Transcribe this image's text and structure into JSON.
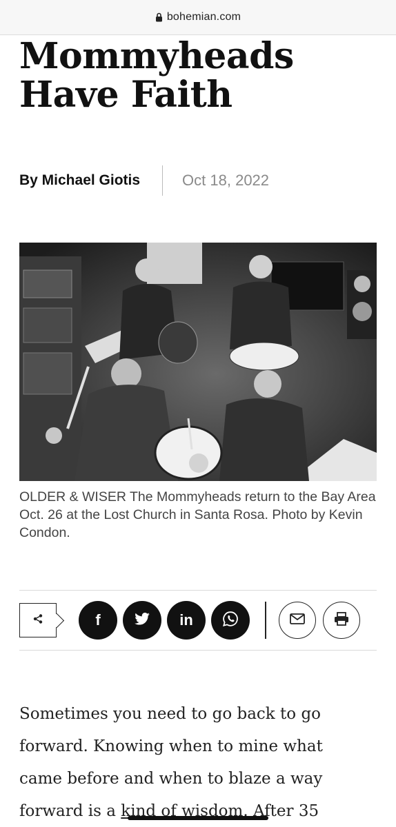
{
  "browser": {
    "url": "bohemian.com"
  },
  "article": {
    "title": "Mommyheads Have Faith",
    "author": "By Michael Giotis",
    "date": "Oct 18, 2022",
    "caption": "OLDER & WISER The Mommyheads return to the Bay Area Oct. 26 at the Lost Church in Santa Rosa. Photo by Kevin Condon.",
    "body_before_link": "Sometimes you need to go back to go forward. Knowing when to mine what came before and when to blaze a way forward is a ",
    "body_link": "kind of wisdom.",
    "body_after_link": " After 35"
  },
  "share": {
    "buttons": [
      {
        "name": "facebook",
        "glyph": "f"
      },
      {
        "name": "twitter",
        "icon": "bird-icon"
      },
      {
        "name": "linkedin",
        "glyph": "in"
      },
      {
        "name": "whatsapp",
        "icon": "whatsapp-icon"
      }
    ],
    "email_icon": "envelope-icon",
    "print_icon": "printer-icon",
    "share_icon": "share-icon"
  },
  "colors": {
    "text": "#111111",
    "date_gray": "#8a8a8a",
    "caption_gray": "#444444",
    "button_black": "#111111"
  }
}
